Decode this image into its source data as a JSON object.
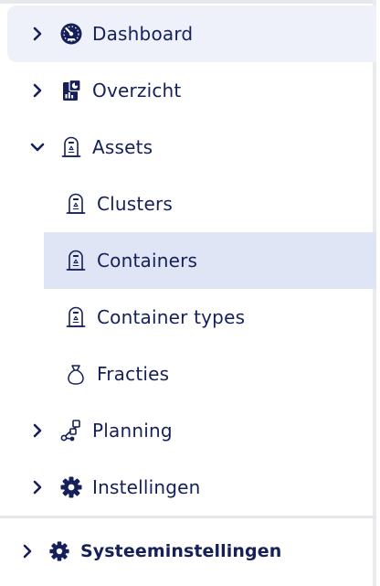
{
  "colors": {
    "text": "#15205a",
    "active_bg": "#eef1fa",
    "selected_bg": "#dfe5f4",
    "rule": "#e6e8ec"
  },
  "nav": {
    "items": [
      {
        "label": "Dashboard",
        "icon": "speedometer-icon",
        "expanded": false
      },
      {
        "label": "Overzicht",
        "icon": "report-icon",
        "expanded": false
      },
      {
        "label": "Assets",
        "icon": "container-bin-icon",
        "expanded": true,
        "children": [
          {
            "label": "Clusters",
            "icon": "container-bin-icon"
          },
          {
            "label": "Containers",
            "icon": "container-bin-icon",
            "selected": true
          },
          {
            "label": "Container types",
            "icon": "container-bin-icon"
          },
          {
            "label": "Fracties",
            "icon": "bag-icon"
          }
        ]
      },
      {
        "label": "Planning",
        "icon": "route-icon",
        "expanded": false
      },
      {
        "label": "Instellingen",
        "icon": "gear-icon",
        "expanded": false
      }
    ]
  },
  "footer": {
    "label": "Systeeminstellingen",
    "icon": "gear-icon"
  }
}
